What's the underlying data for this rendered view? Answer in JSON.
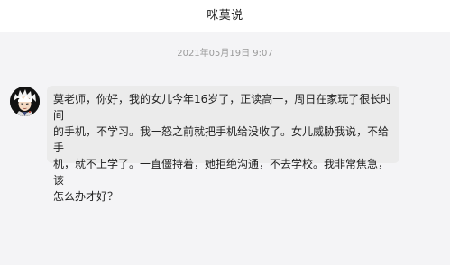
{
  "header": {
    "title": "咪莫说"
  },
  "chat": {
    "timestamp": "2021年05月19日  9:07",
    "message": {
      "avatar_icon": "cartoon-avatar-icon",
      "text": "莫老师，你好，我的女儿今年16岁了，正读高一，周日在家玩了很长时间\n的手机，不学习。我一怒之前就把手机给没收了。女儿威胁我说，不给手\n机，就不上学了。一直僵持着，她拒绝沟通，不去学校。我非常焦急，该\n怎么办才好？"
    }
  }
}
